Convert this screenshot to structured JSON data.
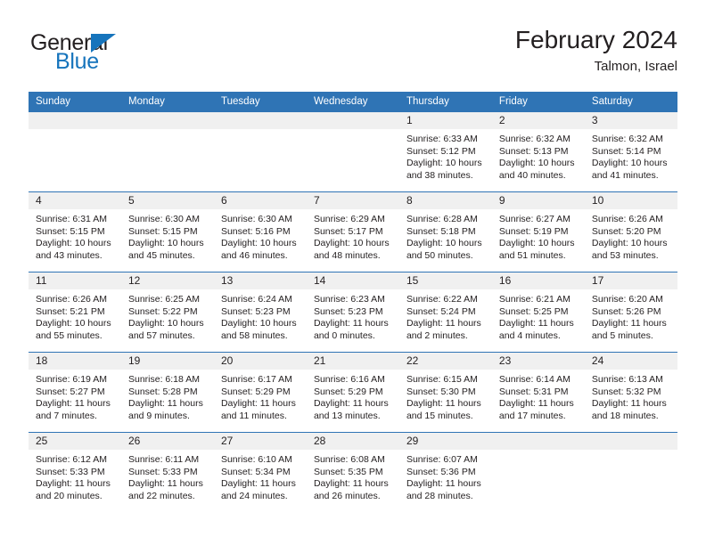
{
  "brand": {
    "word1": "General",
    "word2": "Blue",
    "accent_color": "#1674bc",
    "triangle_icon": "triangle-icon"
  },
  "header": {
    "title": "February 2024",
    "subtitle": "Talmon, Israel"
  },
  "theme": {
    "header_blue": "#2f74b5",
    "daynum_band": "#f0f0f0",
    "text": "#231f20"
  },
  "calendar": {
    "weekday_headers": [
      "Sunday",
      "Monday",
      "Tuesday",
      "Wednesday",
      "Thursday",
      "Friday",
      "Saturday"
    ],
    "weeks": [
      [
        {
          "day": "",
          "sunrise": "",
          "sunset": "",
          "daylight1": "",
          "daylight2": ""
        },
        {
          "day": "",
          "sunrise": "",
          "sunset": "",
          "daylight1": "",
          "daylight2": ""
        },
        {
          "day": "",
          "sunrise": "",
          "sunset": "",
          "daylight1": "",
          "daylight2": ""
        },
        {
          "day": "",
          "sunrise": "",
          "sunset": "",
          "daylight1": "",
          "daylight2": ""
        },
        {
          "day": "1",
          "sunrise": "Sunrise: 6:33 AM",
          "sunset": "Sunset: 5:12 PM",
          "daylight1": "Daylight: 10 hours",
          "daylight2": "and 38 minutes."
        },
        {
          "day": "2",
          "sunrise": "Sunrise: 6:32 AM",
          "sunset": "Sunset: 5:13 PM",
          "daylight1": "Daylight: 10 hours",
          "daylight2": "and 40 minutes."
        },
        {
          "day": "3",
          "sunrise": "Sunrise: 6:32 AM",
          "sunset": "Sunset: 5:14 PM",
          "daylight1": "Daylight: 10 hours",
          "daylight2": "and 41 minutes."
        }
      ],
      [
        {
          "day": "4",
          "sunrise": "Sunrise: 6:31 AM",
          "sunset": "Sunset: 5:15 PM",
          "daylight1": "Daylight: 10 hours",
          "daylight2": "and 43 minutes."
        },
        {
          "day": "5",
          "sunrise": "Sunrise: 6:30 AM",
          "sunset": "Sunset: 5:15 PM",
          "daylight1": "Daylight: 10 hours",
          "daylight2": "and 45 minutes."
        },
        {
          "day": "6",
          "sunrise": "Sunrise: 6:30 AM",
          "sunset": "Sunset: 5:16 PM",
          "daylight1": "Daylight: 10 hours",
          "daylight2": "and 46 minutes."
        },
        {
          "day": "7",
          "sunrise": "Sunrise: 6:29 AM",
          "sunset": "Sunset: 5:17 PM",
          "daylight1": "Daylight: 10 hours",
          "daylight2": "and 48 minutes."
        },
        {
          "day": "8",
          "sunrise": "Sunrise: 6:28 AM",
          "sunset": "Sunset: 5:18 PM",
          "daylight1": "Daylight: 10 hours",
          "daylight2": "and 50 minutes."
        },
        {
          "day": "9",
          "sunrise": "Sunrise: 6:27 AM",
          "sunset": "Sunset: 5:19 PM",
          "daylight1": "Daylight: 10 hours",
          "daylight2": "and 51 minutes."
        },
        {
          "day": "10",
          "sunrise": "Sunrise: 6:26 AM",
          "sunset": "Sunset: 5:20 PM",
          "daylight1": "Daylight: 10 hours",
          "daylight2": "and 53 minutes."
        }
      ],
      [
        {
          "day": "11",
          "sunrise": "Sunrise: 6:26 AM",
          "sunset": "Sunset: 5:21 PM",
          "daylight1": "Daylight: 10 hours",
          "daylight2": "and 55 minutes."
        },
        {
          "day": "12",
          "sunrise": "Sunrise: 6:25 AM",
          "sunset": "Sunset: 5:22 PM",
          "daylight1": "Daylight: 10 hours",
          "daylight2": "and 57 minutes."
        },
        {
          "day": "13",
          "sunrise": "Sunrise: 6:24 AM",
          "sunset": "Sunset: 5:23 PM",
          "daylight1": "Daylight: 10 hours",
          "daylight2": "and 58 minutes."
        },
        {
          "day": "14",
          "sunrise": "Sunrise: 6:23 AM",
          "sunset": "Sunset: 5:23 PM",
          "daylight1": "Daylight: 11 hours",
          "daylight2": "and 0 minutes."
        },
        {
          "day": "15",
          "sunrise": "Sunrise: 6:22 AM",
          "sunset": "Sunset: 5:24 PM",
          "daylight1": "Daylight: 11 hours",
          "daylight2": "and 2 minutes."
        },
        {
          "day": "16",
          "sunrise": "Sunrise: 6:21 AM",
          "sunset": "Sunset: 5:25 PM",
          "daylight1": "Daylight: 11 hours",
          "daylight2": "and 4 minutes."
        },
        {
          "day": "17",
          "sunrise": "Sunrise: 6:20 AM",
          "sunset": "Sunset: 5:26 PM",
          "daylight1": "Daylight: 11 hours",
          "daylight2": "and 5 minutes."
        }
      ],
      [
        {
          "day": "18",
          "sunrise": "Sunrise: 6:19 AM",
          "sunset": "Sunset: 5:27 PM",
          "daylight1": "Daylight: 11 hours",
          "daylight2": "and 7 minutes."
        },
        {
          "day": "19",
          "sunrise": "Sunrise: 6:18 AM",
          "sunset": "Sunset: 5:28 PM",
          "daylight1": "Daylight: 11 hours",
          "daylight2": "and 9 minutes."
        },
        {
          "day": "20",
          "sunrise": "Sunrise: 6:17 AM",
          "sunset": "Sunset: 5:29 PM",
          "daylight1": "Daylight: 11 hours",
          "daylight2": "and 11 minutes."
        },
        {
          "day": "21",
          "sunrise": "Sunrise: 6:16 AM",
          "sunset": "Sunset: 5:29 PM",
          "daylight1": "Daylight: 11 hours",
          "daylight2": "and 13 minutes."
        },
        {
          "day": "22",
          "sunrise": "Sunrise: 6:15 AM",
          "sunset": "Sunset: 5:30 PM",
          "daylight1": "Daylight: 11 hours",
          "daylight2": "and 15 minutes."
        },
        {
          "day": "23",
          "sunrise": "Sunrise: 6:14 AM",
          "sunset": "Sunset: 5:31 PM",
          "daylight1": "Daylight: 11 hours",
          "daylight2": "and 17 minutes."
        },
        {
          "day": "24",
          "sunrise": "Sunrise: 6:13 AM",
          "sunset": "Sunset: 5:32 PM",
          "daylight1": "Daylight: 11 hours",
          "daylight2": "and 18 minutes."
        }
      ],
      [
        {
          "day": "25",
          "sunrise": "Sunrise: 6:12 AM",
          "sunset": "Sunset: 5:33 PM",
          "daylight1": "Daylight: 11 hours",
          "daylight2": "and 20 minutes."
        },
        {
          "day": "26",
          "sunrise": "Sunrise: 6:11 AM",
          "sunset": "Sunset: 5:33 PM",
          "daylight1": "Daylight: 11 hours",
          "daylight2": "and 22 minutes."
        },
        {
          "day": "27",
          "sunrise": "Sunrise: 6:10 AM",
          "sunset": "Sunset: 5:34 PM",
          "daylight1": "Daylight: 11 hours",
          "daylight2": "and 24 minutes."
        },
        {
          "day": "28",
          "sunrise": "Sunrise: 6:08 AM",
          "sunset": "Sunset: 5:35 PM",
          "daylight1": "Daylight: 11 hours",
          "daylight2": "and 26 minutes."
        },
        {
          "day": "29",
          "sunrise": "Sunrise: 6:07 AM",
          "sunset": "Sunset: 5:36 PM",
          "daylight1": "Daylight: 11 hours",
          "daylight2": "and 28 minutes."
        },
        {
          "day": "",
          "sunrise": "",
          "sunset": "",
          "daylight1": "",
          "daylight2": ""
        },
        {
          "day": "",
          "sunrise": "",
          "sunset": "",
          "daylight1": "",
          "daylight2": ""
        }
      ]
    ]
  }
}
